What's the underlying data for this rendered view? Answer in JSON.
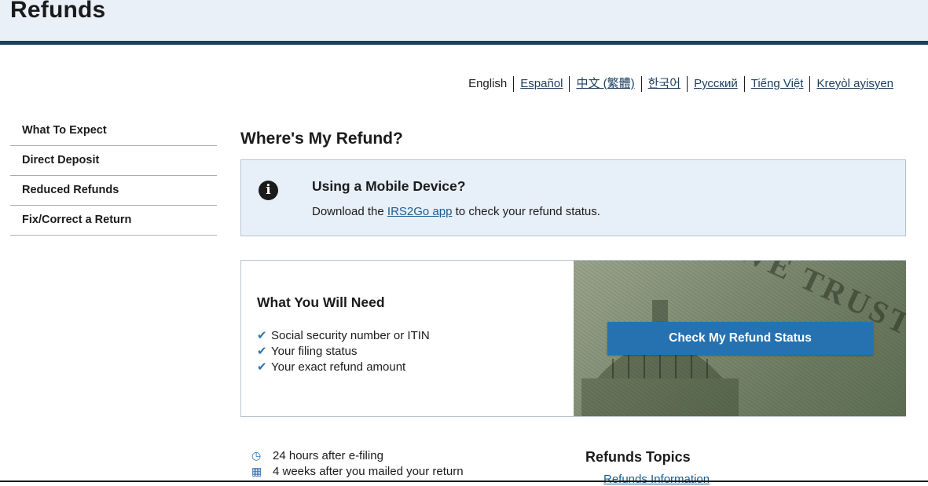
{
  "header": {
    "title": "Refunds"
  },
  "languages": [
    {
      "label": "English",
      "current": true
    },
    {
      "label": "Español"
    },
    {
      "label": "中文 (繁體)"
    },
    {
      "label": "한국어"
    },
    {
      "label": "Русский"
    },
    {
      "label": "Tiếng Việt"
    },
    {
      "label": "Kreyòl ayisyen"
    }
  ],
  "sidebar": {
    "items": [
      {
        "label": "What To Expect"
      },
      {
        "label": "Direct Deposit"
      },
      {
        "label": "Reduced Refunds"
      },
      {
        "label": "Fix/Correct a Return"
      }
    ]
  },
  "main": {
    "title": "Where's My Refund?",
    "alert": {
      "heading": "Using a Mobile Device?",
      "body_prefix": "Download the ",
      "link": "IRS2Go app",
      "body_suffix": " to check your refund status."
    },
    "need": {
      "heading": "What You Will Need",
      "items": [
        "Social security number or ITIN",
        "Your filing status",
        "Your exact refund amount"
      ]
    },
    "image": {
      "motto": "WE TRUST"
    },
    "check_button": "Check My Refund Status",
    "timeline": [
      {
        "icon": "clock-icon",
        "text": "24 hours after e-filing"
      },
      {
        "icon": "calendar-icon",
        "text": "4 weeks after you mailed your return"
      }
    ],
    "topics": {
      "heading": "Refunds Topics",
      "first_link": "Refunds Information"
    }
  },
  "colors": {
    "header_bg": "#e9f0f8",
    "header_border": "#1d3f60",
    "accent": "#2672b1",
    "alert_bg": "#e7eff8"
  }
}
